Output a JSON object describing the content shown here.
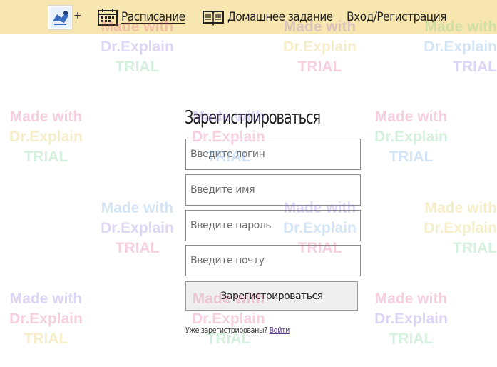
{
  "nav": {
    "plus": "+",
    "schedule": "Расписание",
    "homework": "Домашнее задание",
    "login": "Вход/Регистрация"
  },
  "form": {
    "title": "Зарегистрироваться",
    "login_placeholder": "Введите логин",
    "name_placeholder": "Введите имя",
    "password_placeholder": "Введите пароль",
    "email_placeholder": "Введите почту",
    "submit_label": "Зарегистрироваться",
    "already_text": "Уже зарегистрированы?",
    "login_link": "Войти"
  },
  "watermark": {
    "line1": "Made with",
    "line2": "Dr.Explain",
    "line3": "TRIAL"
  },
  "colors": {
    "topbar": "#f8e6b0",
    "link": "#5a3d9a"
  }
}
